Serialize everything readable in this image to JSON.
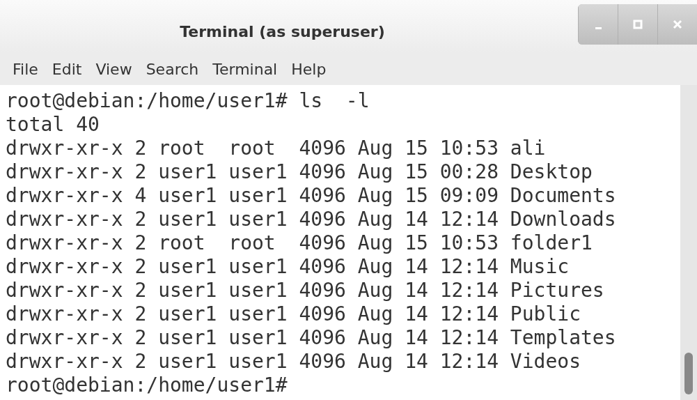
{
  "window": {
    "title": "Terminal (as superuser)"
  },
  "menu": [
    "File",
    "Edit",
    "View",
    "Search",
    "Terminal",
    "Help"
  ],
  "terminal_lines": [
    "root@debian:/home/user1# ls  -l",
    "total 40",
    "drwxr-xr-x 2 root  root  4096 Aug 15 10:53 ali",
    "drwxr-xr-x 2 user1 user1 4096 Aug 15 00:28 Desktop",
    "drwxr-xr-x 4 user1 user1 4096 Aug 15 09:09 Documents",
    "drwxr-xr-x 2 user1 user1 4096 Aug 14 12:14 Downloads",
    "drwxr-xr-x 2 root  root  4096 Aug 15 10:53 folder1",
    "drwxr-xr-x 2 user1 user1 4096 Aug 14 12:14 Music",
    "drwxr-xr-x 2 user1 user1 4096 Aug 14 12:14 Pictures",
    "drwxr-xr-x 2 user1 user1 4096 Aug 14 12:14 Public",
    "drwxr-xr-x 2 user1 user1 4096 Aug 14 12:14 Templates",
    "drwxr-xr-x 2 user1 user1 4096 Aug 14 12:14 Videos",
    "root@debian:/home/user1#"
  ]
}
